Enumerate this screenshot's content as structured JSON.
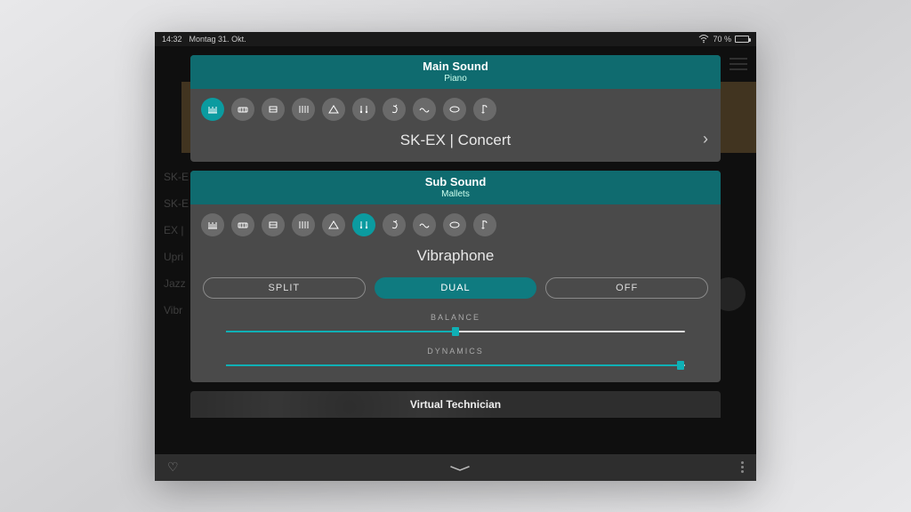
{
  "status": {
    "time": "14:32",
    "date": "Montag 31. Okt.",
    "battery_pct": "70 %"
  },
  "background": {
    "list_items": [
      "SK-E",
      "SK-E",
      "EX |",
      "Upri",
      "Jazz",
      "Vibr"
    ]
  },
  "main_sound": {
    "title": "Main Sound",
    "category": "Piano",
    "selected_sound": "SK-EX | Concert",
    "active_category_index": 0
  },
  "sub_sound": {
    "title": "Sub Sound",
    "category": "Mallets",
    "selected_sound": "Vibraphone",
    "active_category_index": 5
  },
  "modes": {
    "split": "SPLIT",
    "dual": "DUAL",
    "off": "OFF",
    "active": "dual"
  },
  "sliders": {
    "balance": {
      "label": "BALANCE",
      "value_pct": 50
    },
    "dynamics": {
      "label": "DYNAMICS",
      "value_pct": 99
    }
  },
  "virtual_technician": "Virtual Technician",
  "icons": {
    "categories": [
      "piano-icon",
      "epiano-icon",
      "epiano2-icon",
      "organ-icon",
      "harpsichord-icon",
      "mallets-icon",
      "guitar-icon",
      "pad-icon",
      "drums-icon",
      "strings-icon"
    ]
  },
  "colors": {
    "accent": "#0f7b80",
    "accent_bright": "#0fb0b5",
    "panel_bg": "#4a4a4a"
  }
}
